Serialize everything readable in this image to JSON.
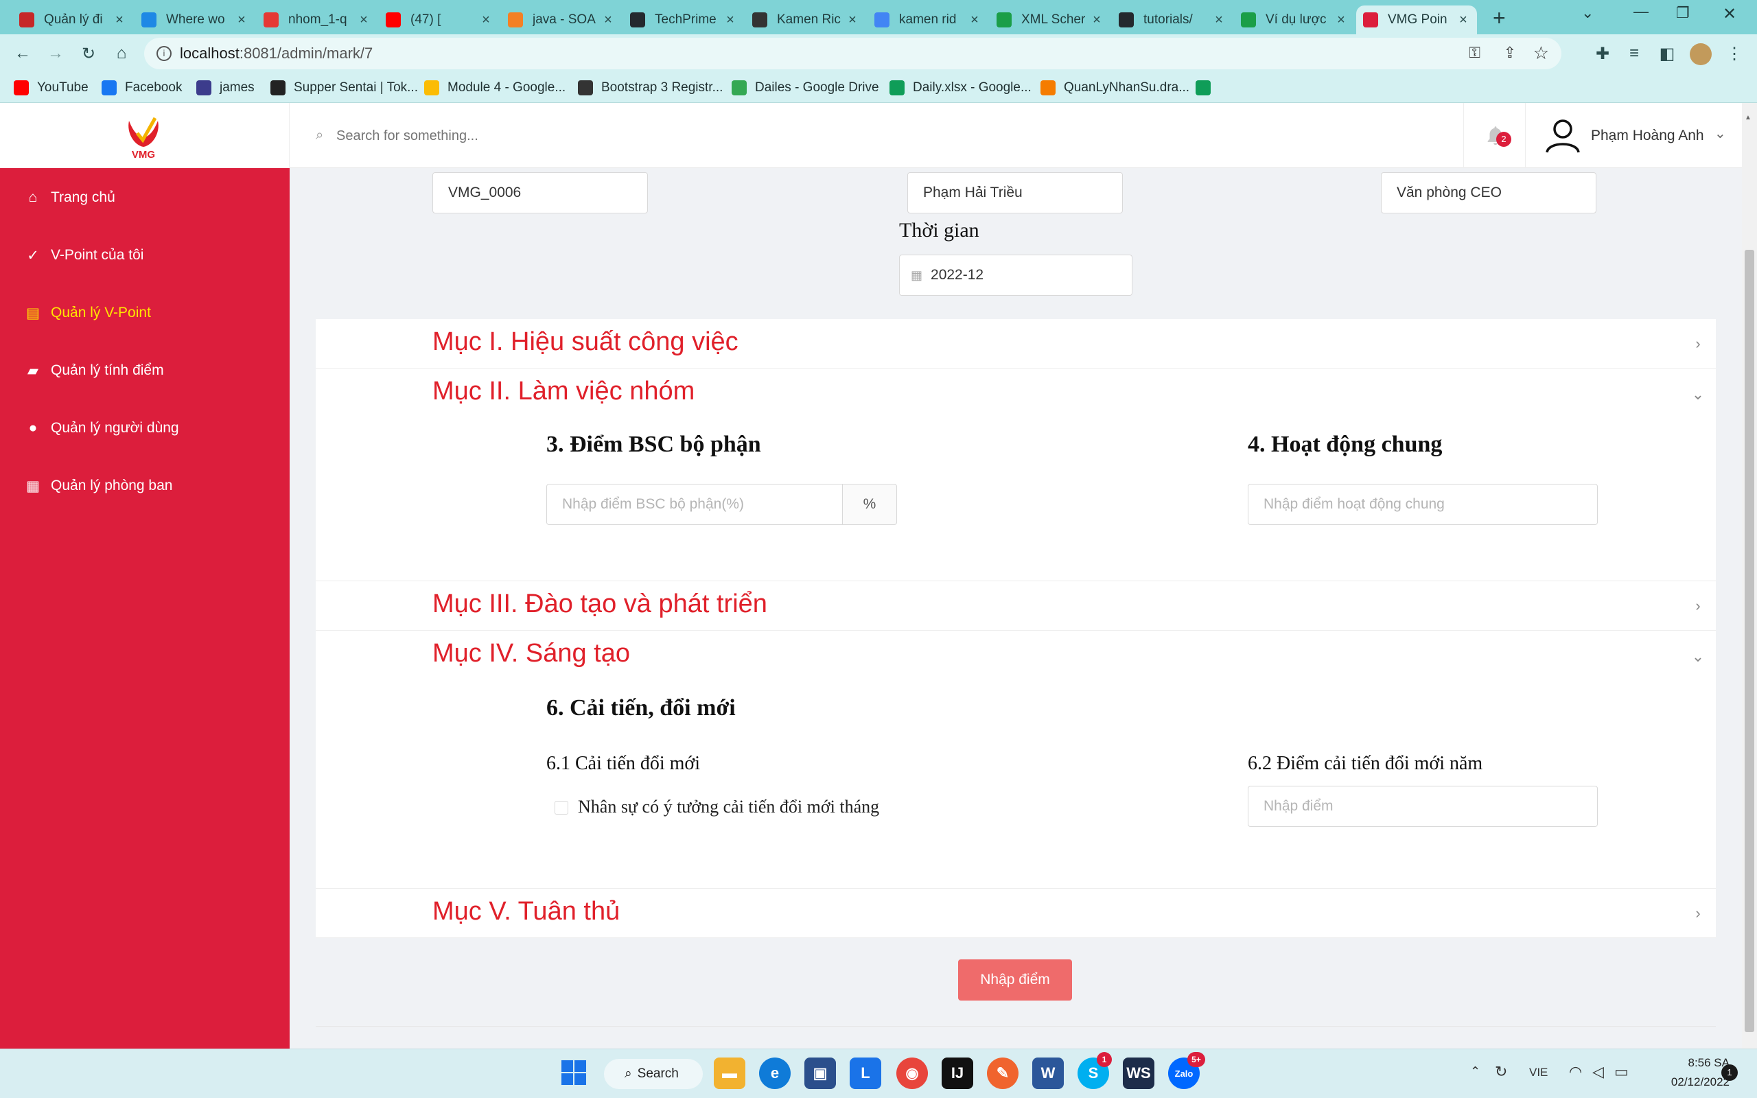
{
  "browser": {
    "tabs": [
      {
        "title": "Quản lý đi",
        "color": "#c62828",
        "active": false
      },
      {
        "title": "Where wo",
        "color": "#1e88e5",
        "active": false
      },
      {
        "title": "nhom_1-q",
        "color": "#e53935",
        "active": false
      },
      {
        "title": "(47) [",
        "color": "#ff0000",
        "active": false
      },
      {
        "title": "java - SOA",
        "color": "#f48024",
        "active": false
      },
      {
        "title": "TechPrime",
        "color": "#24292e",
        "active": false
      },
      {
        "title": "Kamen Ric",
        "color": "#333333",
        "active": false
      },
      {
        "title": "kamen rid",
        "color": "#4285f4",
        "active": false
      },
      {
        "title": "XML Scher",
        "color": "#1b9e48",
        "active": false
      },
      {
        "title": "tutorials/",
        "color": "#24292e",
        "active": false
      },
      {
        "title": "Ví dụ lược",
        "color": "#1b9e48",
        "active": false
      },
      {
        "title": "VMG Poin",
        "color": "#dc1e3c",
        "active": true
      }
    ],
    "new_tab": "+",
    "url_host": "localhost",
    "url_path": ":8081/admin/mark/7",
    "bookmarks": [
      {
        "label": "YouTube",
        "color": "#ff0000"
      },
      {
        "label": "Facebook",
        "color": "#1877f2"
      },
      {
        "label": "james",
        "color": "#3c3c8c"
      },
      {
        "label": "Supper Sentai | Tok...",
        "color": "#222222"
      },
      {
        "label": "Module 4 - Google...",
        "color": "#fbbc04"
      },
      {
        "label": "Bootstrap 3 Registr...",
        "color": "#333333"
      },
      {
        "label": "Dailes - Google Drive",
        "color": "#34a853"
      },
      {
        "label": "Daily.xlsx - Google...",
        "color": "#0f9d58"
      },
      {
        "label": "QuanLyNhanSu.dra...",
        "color": "#f57c00"
      },
      {
        "label": "",
        "color": "#0f9d58"
      }
    ]
  },
  "app": {
    "logo_text": "VMG",
    "search_placeholder": "Search for something...",
    "notification_count": "2",
    "user_name": "Phạm Hoàng Anh",
    "nav": [
      {
        "label": "Trang chủ",
        "icon": "home-icon",
        "active": false
      },
      {
        "label": "V-Point của tôi",
        "icon": "checklist-icon",
        "active": false
      },
      {
        "label": "Quản lý V-Point",
        "icon": "document-icon",
        "active": true
      },
      {
        "label": "Quản lý tính điểm",
        "icon": "wallet-icon",
        "active": false
      },
      {
        "label": "Quản lý người dùng",
        "icon": "user-icon",
        "active": false
      },
      {
        "label": "Quản lý phòng ban",
        "icon": "department-icon",
        "active": false
      }
    ]
  },
  "form": {
    "employee_code": "VMG_0006",
    "employee_name": "Phạm Hải Triều",
    "department": "Văn phòng CEO",
    "time_label": "Thời gian",
    "time_value": "2022-12",
    "sections": {
      "s1": "Mục I. Hiệu suất công việc",
      "s2": "Mục II. Làm việc nhóm",
      "s3": "Mục III. Đào tạo và phát triển",
      "s4": "Mục IV. Sáng tạo",
      "s5": "Mục V. Tuân thủ"
    },
    "bsc_title": "3. Điểm BSC bộ phận",
    "bsc_placeholder": "Nhập điểm BSC bộ phận(%)",
    "bsc_suffix": "%",
    "activity_title": "4. Hoạt động chung",
    "activity_placeholder": "Nhập điểm hoạt động chung",
    "innovation_title": "6. Cải tiến, đổi mới",
    "innovation_sub1": "6.1 Cải tiến đổi mới",
    "innovation_checkbox": "Nhân sự có ý tưởng cải tiến đổi mới tháng",
    "innovation_sub2": "6.2 Điểm cải tiến đổi mới năm",
    "innovation_placeholder": "Nhập điểm",
    "submit_label": "Nhập điểm"
  },
  "taskbar": {
    "search_label": "Search",
    "lang": "VIE",
    "time": "8:56 SA",
    "date": "02/12/2022",
    "notif": "1",
    "skype_badge": "1",
    "zalo_badge": "5+"
  }
}
